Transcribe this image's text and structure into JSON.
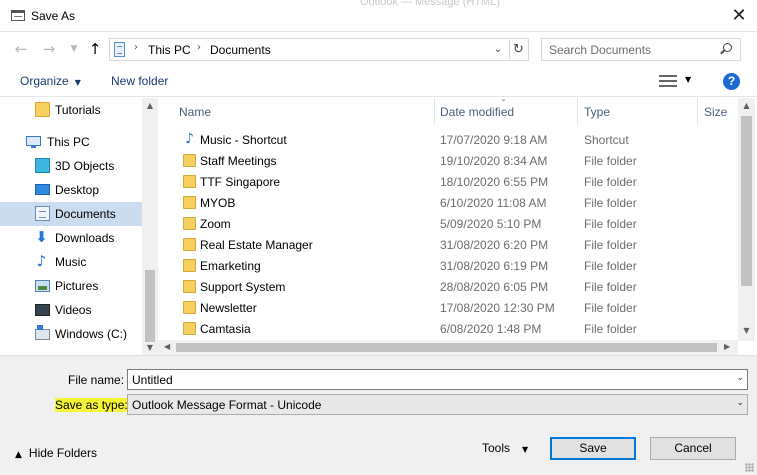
{
  "window": {
    "title": "Save As",
    "ghost_text": "Outlook — Message (HTML)"
  },
  "nav": {
    "crumbs": [
      "This PC",
      "Documents"
    ],
    "search_placeholder": "Search Documents"
  },
  "toolbar": {
    "organize": "Organize",
    "new_folder": "New folder"
  },
  "sidebar": {
    "items": [
      {
        "label": "Tutorials",
        "icon": "folder-icon"
      },
      {
        "label": "This PC",
        "icon": "computer-icon"
      },
      {
        "label": "3D Objects",
        "icon": "cube-icon"
      },
      {
        "label": "Desktop",
        "icon": "desktop-icon"
      },
      {
        "label": "Documents",
        "icon": "documents-icon",
        "selected": true
      },
      {
        "label": "Downloads",
        "icon": "download-arrow-icon"
      },
      {
        "label": "Music",
        "icon": "music-note-icon"
      },
      {
        "label": "Pictures",
        "icon": "pictures-icon"
      },
      {
        "label": "Videos",
        "icon": "videos-icon"
      },
      {
        "label": "Windows (C:)",
        "icon": "drive-icon"
      }
    ]
  },
  "columns": [
    "Name",
    "Date modified",
    "Type",
    "Size"
  ],
  "files": [
    {
      "name": "Music - Shortcut",
      "date": "17/07/2020 9:18 AM",
      "type": "Shortcut",
      "icon": "shortcut-icon"
    },
    {
      "name": "Staff Meetings",
      "date": "19/10/2020 8:34 AM",
      "type": "File folder",
      "icon": "folder-icon"
    },
    {
      "name": "TTF Singapore",
      "date": "18/10/2020 6:55 PM",
      "type": "File folder",
      "icon": "folder-icon"
    },
    {
      "name": "MYOB",
      "date": "6/10/2020 11:08 AM",
      "type": "File folder",
      "icon": "folder-icon"
    },
    {
      "name": "Zoom",
      "date": "5/09/2020 5:10 PM",
      "type": "File folder",
      "icon": "folder-icon"
    },
    {
      "name": "Real Estate Manager",
      "date": "31/08/2020 6:20 PM",
      "type": "File folder",
      "icon": "folder-icon"
    },
    {
      "name": "Emarketing",
      "date": "31/08/2020 6:19 PM",
      "type": "File folder",
      "icon": "folder-icon"
    },
    {
      "name": "Support System",
      "date": "28/08/2020 6:05 PM",
      "type": "File folder",
      "icon": "folder-icon"
    },
    {
      "name": "Newsletter",
      "date": "17/08/2020 12:30 PM",
      "type": "File folder",
      "icon": "folder-icon"
    },
    {
      "name": "Camtasia",
      "date": "6/08/2020 1:48 PM",
      "type": "File folder",
      "icon": "folder-icon"
    }
  ],
  "form": {
    "file_name_label": "File name:",
    "file_name_value": "Untitled",
    "save_type_label": "Save as type:",
    "save_type_value": "Outlook Message Format - Unicode"
  },
  "footer": {
    "hide_folders": "Hide Folders",
    "tools": "Tools",
    "save": "Save",
    "cancel": "Cancel"
  },
  "colors": {
    "accent": "#0078d7",
    "selection": "#ccdcef",
    "highlight": "#f5f533",
    "folder": "#f7cf5f"
  }
}
